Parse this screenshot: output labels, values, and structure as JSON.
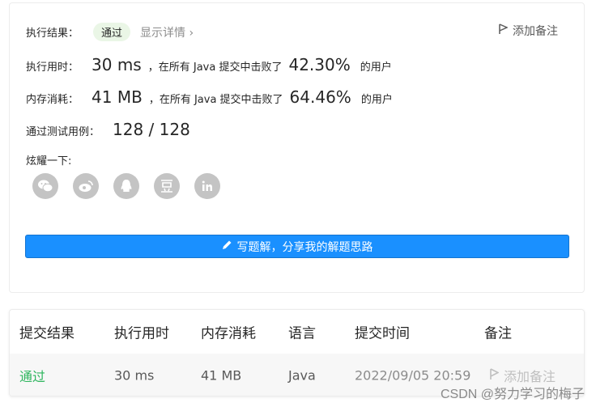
{
  "summary": {
    "result_label": "执行结果：",
    "result_value": "通过",
    "details_link": "显示详情 ›",
    "add_remark": "添加备注",
    "runtime": {
      "label": "执行用时：",
      "value": "30 ms",
      "text": "，在所有 Java 提交中击败了",
      "percent": "42.30%",
      "suffix": "的用户"
    },
    "memory": {
      "label": "内存消耗：",
      "value": "41 MB",
      "text": "，在所有 Java 提交中击败了",
      "percent": "64.46%",
      "suffix": "的用户"
    },
    "testcases": {
      "label": "通过测试用例：",
      "value": "128 / 128"
    },
    "share_label": "炫耀一下:",
    "share_icons": [
      "wechat-icon",
      "weibo-icon",
      "qq-icon",
      "douban-icon",
      "linkedin-icon"
    ],
    "write_button": "写题解，分享我的解题思路"
  },
  "table": {
    "headers": [
      "提交结果",
      "执行用时",
      "内存消耗",
      "语言",
      "提交时间",
      "备注"
    ],
    "rows": [
      {
        "result": "通过",
        "runtime": "30 ms",
        "memory": "41 MB",
        "language": "Java",
        "time": "2022/09/05 20:59",
        "remark": "添加备注"
      }
    ]
  },
  "watermark": "CSDN @努力学习的梅子",
  "colors": {
    "accent": "#1a90ff",
    "pass": "#2db55d",
    "badge_bg": "#eaf6e6"
  }
}
